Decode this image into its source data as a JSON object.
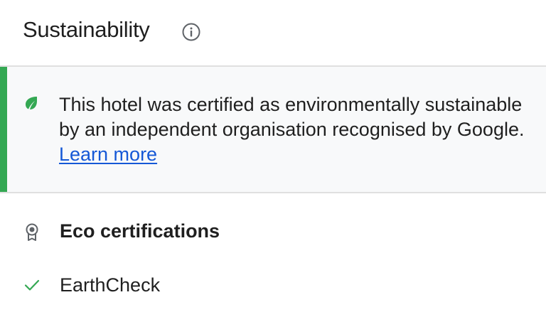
{
  "header": {
    "title": "Sustainability",
    "info_icon": "info-icon"
  },
  "callout": {
    "icon": "leaf-icon",
    "text": "This hotel was certified as environmentally sustainable by an independent organisation recognised by Google. ",
    "link_label": "Learn more",
    "accent_color": "#34a853",
    "link_color": "#1558d6"
  },
  "certifications": {
    "icon": "award-icon",
    "heading": "Eco certifications",
    "items": [
      {
        "icon": "check-icon",
        "label": "EarthCheck"
      }
    ]
  }
}
